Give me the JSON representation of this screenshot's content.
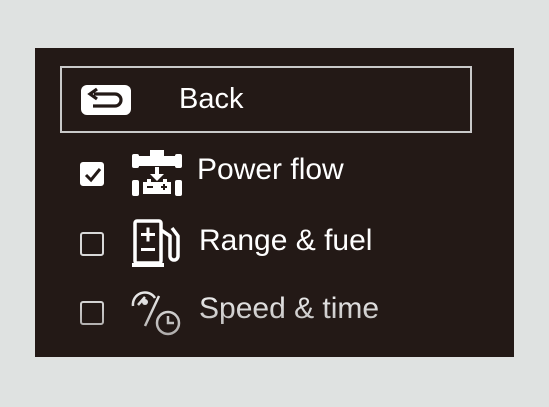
{
  "menu": {
    "back": {
      "label": "Back",
      "icon": "back-arrow-icon"
    },
    "options": [
      {
        "label": "Power flow",
        "checked": true,
        "icon": "power-flow-icon"
      },
      {
        "label": "Range & fuel",
        "checked": false,
        "icon": "fuel-pump-icon"
      },
      {
        "label": "Speed & time",
        "checked": false,
        "icon": "speedometer-clock-icon"
      }
    ]
  },
  "colors": {
    "screen_background": "#231916",
    "page_background": "#dfe2e1",
    "text": "#ffffff",
    "border": "#c9c9c9"
  }
}
